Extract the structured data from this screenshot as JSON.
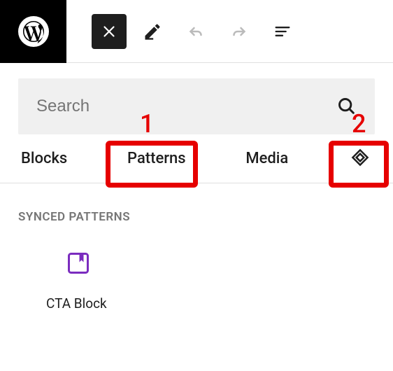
{
  "topbar": {
    "logo": "wordpress"
  },
  "toolbar": {
    "close": "close",
    "edit": "edit",
    "undo": "undo",
    "redo": "redo",
    "outline": "document-outline"
  },
  "search": {
    "placeholder": "Search"
  },
  "tabs": {
    "blocks": "Blocks",
    "patterns": "Patterns",
    "media": "Media",
    "synced": "Synced patterns"
  },
  "section": {
    "title": "SYNCED PATTERNS"
  },
  "items": [
    {
      "label": "CTA Block"
    }
  ],
  "annotations": {
    "1": "1",
    "2": "2"
  }
}
